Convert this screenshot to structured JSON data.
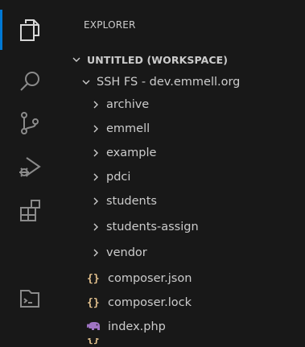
{
  "sidebar": {
    "title": "EXPLORER",
    "workspace": {
      "label": "UNTITLED (WORKSPACE)"
    },
    "root": {
      "label": "SSH FS - dev.emmell.org"
    },
    "folders": [
      {
        "label": "archive"
      },
      {
        "label": "emmell"
      },
      {
        "label": "example"
      },
      {
        "label": "pdci"
      },
      {
        "label": "students"
      },
      {
        "label": "students-assign"
      },
      {
        "label": "vendor"
      }
    ],
    "files": [
      {
        "label": "composer.json",
        "icon": "json-braces-icon",
        "icon_glyph": "{}"
      },
      {
        "label": "composer.lock",
        "icon": "json-braces-icon",
        "icon_glyph": "{}"
      },
      {
        "label": "index.php",
        "icon": "php-elephant-icon",
        "icon_glyph": ""
      }
    ]
  },
  "activity_bar": {
    "items": [
      {
        "name": "explorer-icon",
        "active": true
      },
      {
        "name": "search-icon",
        "active": false
      },
      {
        "name": "source-control-icon",
        "active": false
      },
      {
        "name": "run-debug-icon",
        "active": false
      },
      {
        "name": "extensions-icon",
        "active": false
      },
      {
        "name": "remote-terminal-icon",
        "active": false
      }
    ]
  },
  "colors": {
    "background": "#181818",
    "text": "#cccccc",
    "active_indicator": "#0078d4",
    "json_icon": "#e2c08d",
    "php_icon": "#a074c4"
  }
}
